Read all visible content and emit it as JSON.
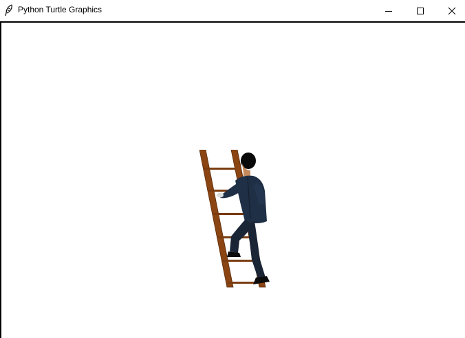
{
  "window": {
    "title": "Python Turtle Graphics",
    "icons": {
      "app": "feather-icon",
      "minimize": "minimize-icon",
      "maximize": "maximize-icon",
      "close": "close-icon"
    }
  },
  "canvas": {
    "background": "#ffffff",
    "border_color": "#000000",
    "image_subject": "man-climbing-ladder"
  },
  "colors": {
    "ladder_wood": "#8b4513",
    "suit": "#1f2f45",
    "hair": "#0a0a0a",
    "skin": "#c48a5c"
  }
}
